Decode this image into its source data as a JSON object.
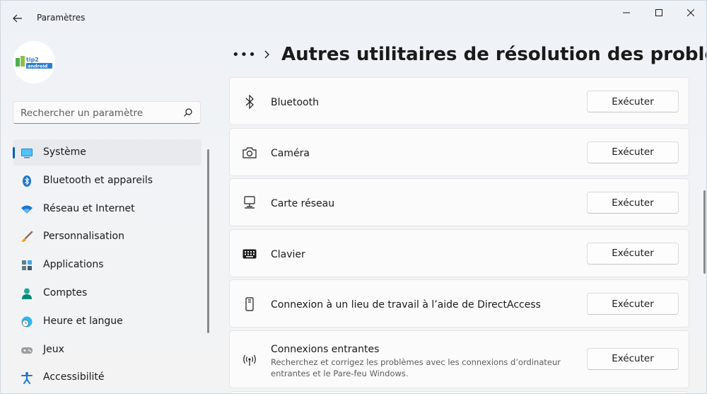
{
  "window": {
    "title": "Paramètres",
    "controls": [
      "minimize",
      "maximize",
      "close"
    ]
  },
  "profile": {
    "avatar_text_line1": "tip2",
    "avatar_text_line2": "android"
  },
  "search": {
    "placeholder": "Rechercher un paramètre",
    "value": ""
  },
  "sidebar": {
    "items": [
      {
        "label": "Système",
        "icon": "system-icon",
        "active": true
      },
      {
        "label": "Bluetooth et appareils",
        "icon": "bluetooth-devices-icon",
        "active": false
      },
      {
        "label": "Réseau et Internet",
        "icon": "wifi-icon",
        "active": false
      },
      {
        "label": "Personnalisation",
        "icon": "brush-icon",
        "active": false
      },
      {
        "label": "Applications",
        "icon": "apps-icon",
        "active": false
      },
      {
        "label": "Comptes",
        "icon": "account-icon",
        "active": false
      },
      {
        "label": "Heure et langue",
        "icon": "time-language-icon",
        "active": false
      },
      {
        "label": "Jeux",
        "icon": "gamepad-icon",
        "active": false
      },
      {
        "label": "Accessibilité",
        "icon": "accessibility-icon",
        "active": false
      }
    ]
  },
  "breadcrumb": {
    "more": "•••",
    "title": "Autres utilitaires de résolution des problèmes"
  },
  "troubleshooters": [
    {
      "label": "Bluetooth",
      "icon": "bluetooth-icon",
      "button": "Exécuter"
    },
    {
      "label": "Caméra",
      "icon": "camera-icon",
      "button": "Exécuter"
    },
    {
      "label": "Carte réseau",
      "icon": "network-adapter-icon",
      "button": "Exécuter"
    },
    {
      "label": "Clavier",
      "icon": "keyboard-icon",
      "button": "Exécuter"
    },
    {
      "label": "Connexion à un lieu de travail à l’aide de DirectAccess",
      "icon": "phone-device-icon",
      "button": "Exécuter"
    },
    {
      "label": "Connexions entrantes",
      "description": "Recherchez et corrigez les problèmes avec les connexions d’ordinateur entrantes et le Pare-feu Windows.",
      "icon": "incoming-connection-icon",
      "button": "Exécuter"
    }
  ],
  "colors": {
    "accent": "#005fb8",
    "background": "#f3f3f3",
    "card": "#fbfbfb"
  }
}
